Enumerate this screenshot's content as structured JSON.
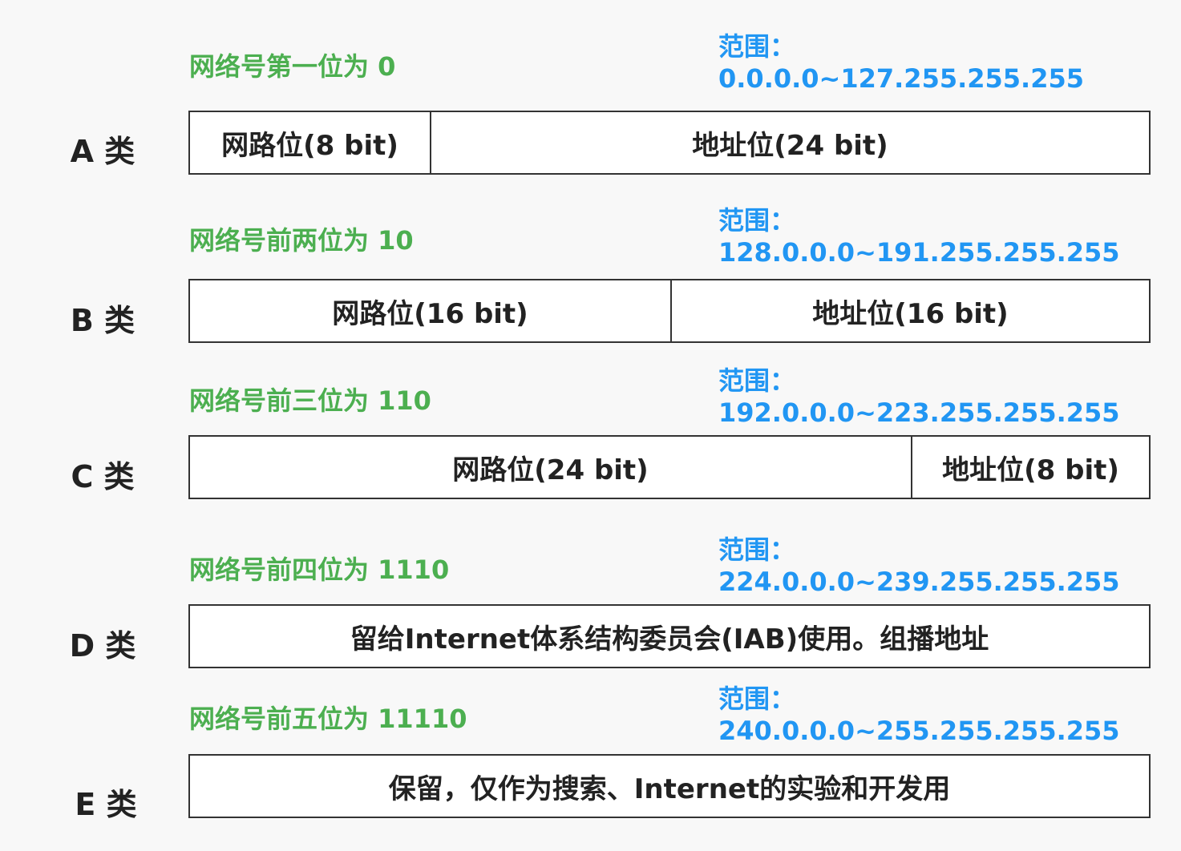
{
  "classes": [
    {
      "label": "A 类",
      "prefix": "网络号第一位为 0",
      "range_title": "范围：",
      "range": "0.0.0.0~127.255.255.255",
      "segments": [
        "网路位(8 bit)",
        "地址位(24 bit)"
      ]
    },
    {
      "label": "B 类",
      "prefix": "网络号前两位为 10",
      "range_title": "范围：",
      "range": "128.0.0.0~191.255.255.255",
      "segments": [
        "网路位(16 bit)",
        "地址位(16 bit)"
      ]
    },
    {
      "label": "C 类",
      "prefix": "网络号前三位为 110",
      "range_title": "范围：",
      "range": "192.0.0.0~223.255.255.255",
      "segments": [
        "网路位(24 bit)",
        "地址位(8 bit)"
      ]
    },
    {
      "label": "D 类",
      "prefix": "网络号前四位为 1110",
      "range_title": "范围：",
      "range": "224.0.0.0~239.255.255.255",
      "segments": [
        "留给Internet体系结构委员会(IAB)使用。组播地址"
      ]
    },
    {
      "label": "E 类",
      "prefix": "网络号前五位为 11110",
      "range_title": "范围：",
      "range": "240.0.0.0~255.255.255.255",
      "segments": [
        "保留，仅作为搜索、Internet的实验和开发用"
      ]
    }
  ]
}
